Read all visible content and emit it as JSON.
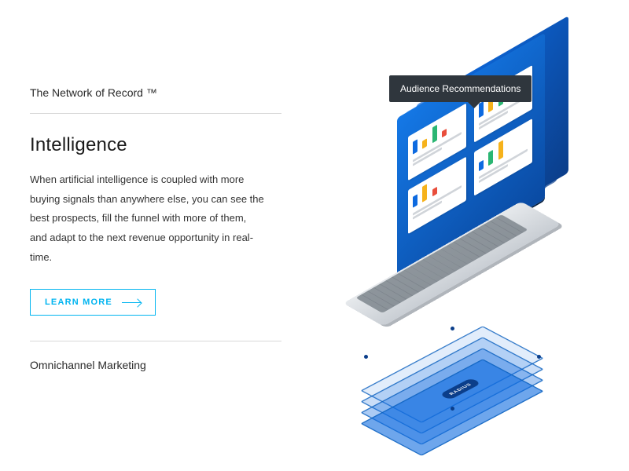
{
  "tabs": {
    "tab1": "The Network of Record ™",
    "tab3": "Omnichannel Marketing"
  },
  "section": {
    "heading": "Intelligence",
    "body": "When artificial intelligence is coupled with more buying signals than anywhere else, you can see the best prospects, fill the funnel with more of them, and adapt to the next revenue opportunity in real-time.",
    "cta_label": "LEARN MORE"
  },
  "illustration": {
    "tooltip": "Audience Recommendations",
    "chip": "RADIUS"
  }
}
